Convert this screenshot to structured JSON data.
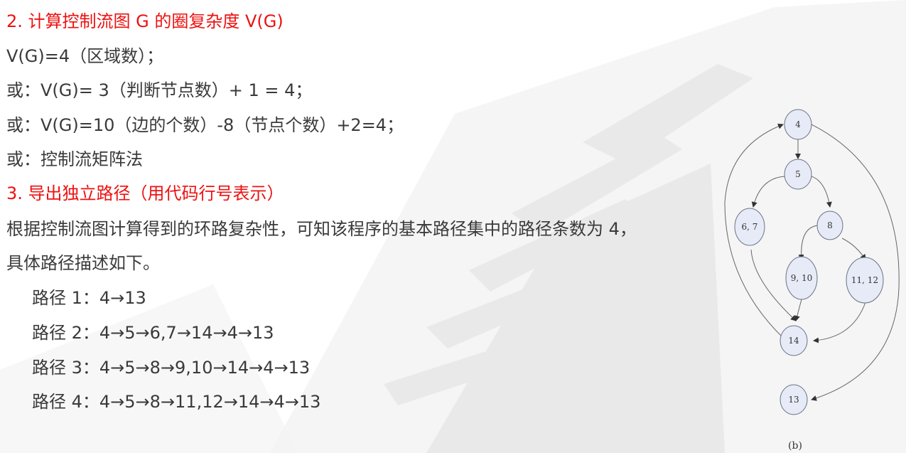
{
  "content": {
    "heading_2": "2. 计算控制流图 G 的圈复杂度 V(G)",
    "method_region": "V(G)=4（区域数）；",
    "method_decision": "或：V(G)= 3（判断节点数）+ 1 = 4；",
    "method_edges": "或：V(G)=10（边的个数）-8（节点个数）+2=4；",
    "method_matrix": "或：控制流矩阵法",
    "heading_3": "3. 导出独立路径（用代码行号表示）",
    "desc_line_1": "根据控制流图计算得到的环路复杂性，可知该程序的基本路径集中的路径条数为 4，",
    "desc_line_2": "具体路径描述如下。",
    "paths": [
      "路径 1：4→13",
      "路径 2：4→5→6,7→14→4→13",
      "路径 3：4→5→8→9,10→14→4→13",
      "路径 4：4→5→8→11,12→14→4→13"
    ]
  },
  "graph": {
    "node_labels": [
      "4",
      "5",
      "6, 7",
      "8",
      "9, 10",
      "11, 12",
      "14",
      "13"
    ],
    "caption": "(b)",
    "node_fill": "#e6ebf7",
    "node_stroke": "#6a7385"
  },
  "colors": {
    "heading": "#ee1111",
    "body_text": "#3a3a3a"
  }
}
